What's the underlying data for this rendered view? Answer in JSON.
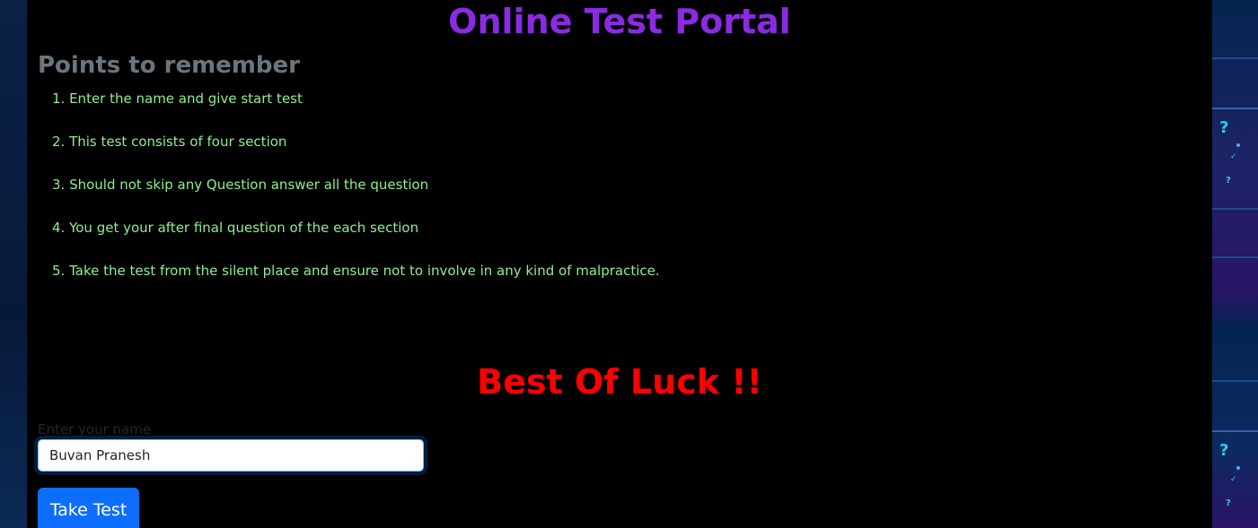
{
  "page": {
    "title": "Online Test Portal",
    "subtitle": "Points to remember",
    "points": [
      "1. Enter the name and give start test",
      "2. This test consists of four section",
      "3. Should not skip any Question answer all the question",
      "4. You get your after final question of the each section",
      "5. Take the test from the silent place and ensure not to involve in any kind of malpractice."
    ],
    "luck_message": "Best Of Luck !!",
    "name_label": "Enter your name",
    "name_value": "Buvan Pranesh",
    "button_label": "Take Test"
  },
  "colors": {
    "title": "#8a2be2",
    "subtitle": "#6c757d",
    "points": "#90ee90",
    "luck": "#ff0000",
    "button": "#0d6efd",
    "panel": "#000000"
  },
  "icons": [
    "question-mark-icon",
    "check-icon"
  ]
}
